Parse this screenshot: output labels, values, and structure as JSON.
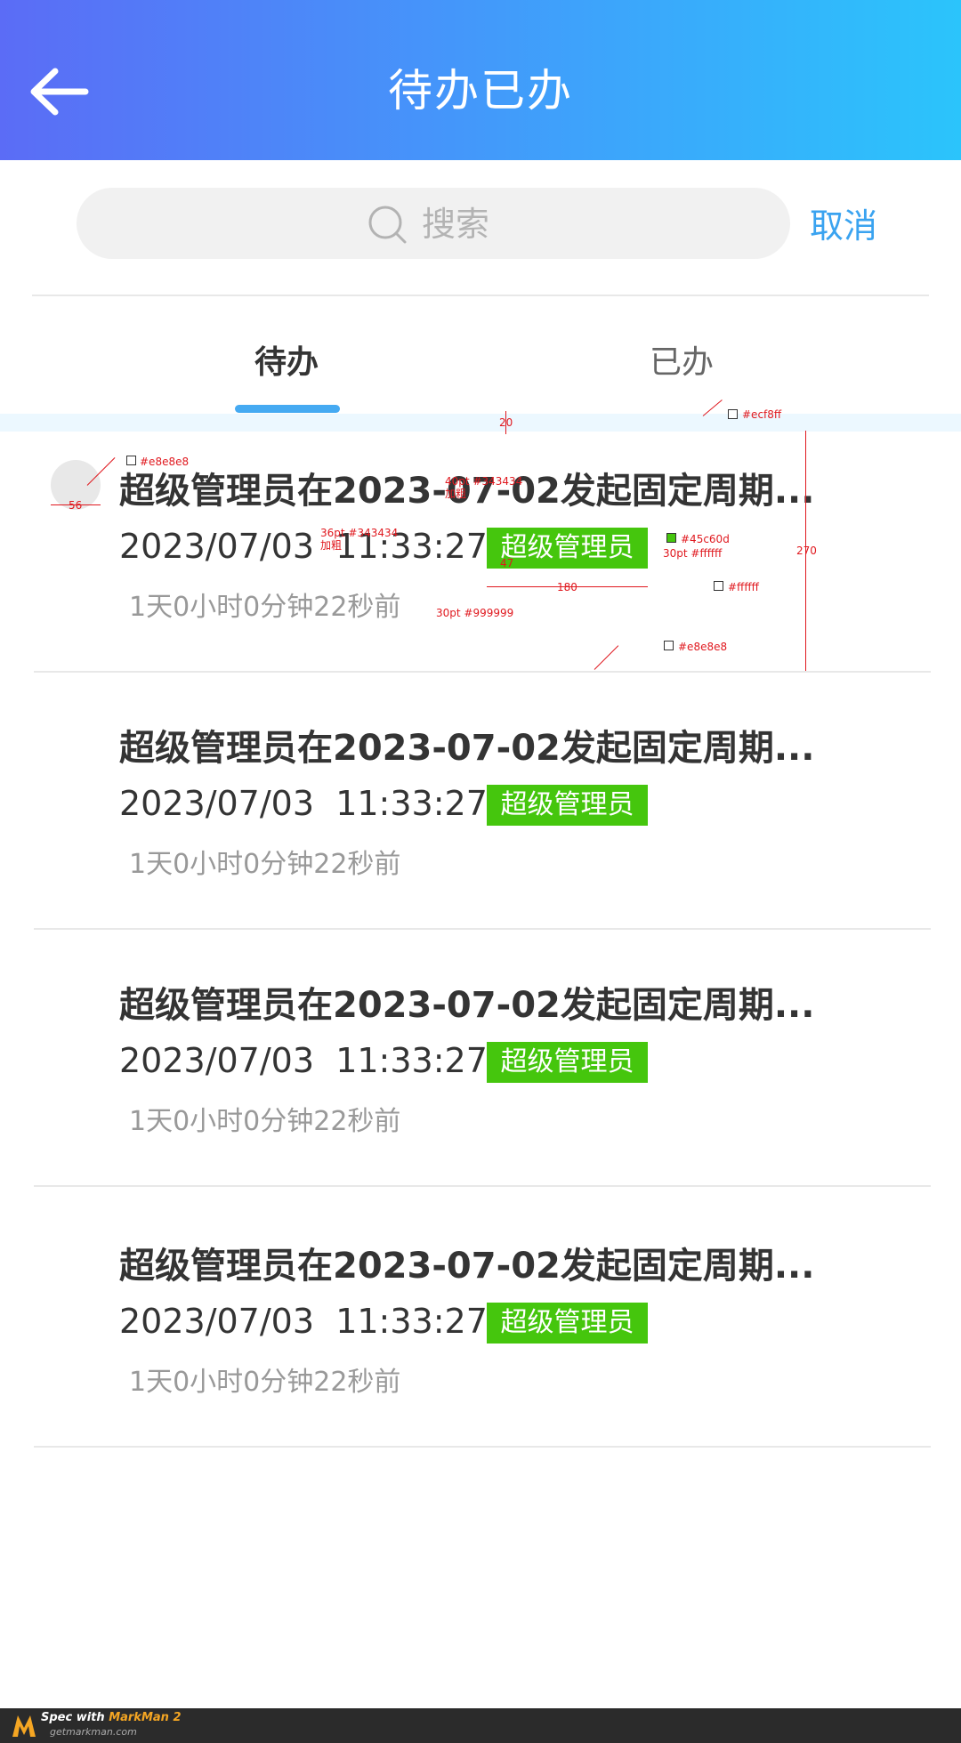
{
  "header": {
    "title": "待办已办"
  },
  "search": {
    "placeholder": "搜索",
    "cancel_label": "取消"
  },
  "tabs": [
    {
      "label": "待办",
      "active": true
    },
    {
      "label": "已办",
      "active": false
    }
  ],
  "items": [
    {
      "title": "超级管理员在2023-07-02发起固定周期...",
      "date": "2023/07/03",
      "time": "11:33:27",
      "tag": "超级管理员",
      "ago": "1天0小时0分钟22秒前"
    },
    {
      "title": "超级管理员在2023-07-02发起固定周期...",
      "date": "2023/07/03",
      "time": "11:33:27",
      "tag": "超级管理员",
      "ago": "1天0小时0分钟22秒前"
    },
    {
      "title": "超级管理员在2023-07-02发起固定周期...",
      "date": "2023/07/03",
      "time": "11:33:27",
      "tag": "超级管理员",
      "ago": "1天0小时0分钟22秒前"
    },
    {
      "title": "超级管理员在2023-07-02发起固定周期...",
      "date": "2023/07/03",
      "time": "11:33:27",
      "tag": "超级管理员",
      "ago": "1天0小时0分钟22秒前"
    }
  ],
  "annotations": {
    "band_color": "#ecf8ff",
    "band_height": "20",
    "avatar_color": "#e8e8e8",
    "avatar_size": "56",
    "title_spec": "40pt #343434",
    "title_weight": "加粗",
    "datetime_spec": "36pt #343434",
    "datetime_weight": "加粗",
    "tag_color": "#45c60d",
    "tag_text_spec": "30pt #ffffff",
    "tag_height": "47",
    "tag_width": "180",
    "bg_color": "#ffffff",
    "ago_spec": "30pt #999999",
    "divider_color": "#e8e8e8",
    "item_height": "270"
  },
  "colors": {
    "accent": "#3aa3f0",
    "tag_green": "#45c60d",
    "text_dark": "#343434",
    "text_gray": "#999999",
    "divider": "#e8e8e8"
  },
  "footer": {
    "brand_prefix": "Spec with ",
    "brand_name": "MarkMan 2",
    "site": "getmarkman.com"
  }
}
